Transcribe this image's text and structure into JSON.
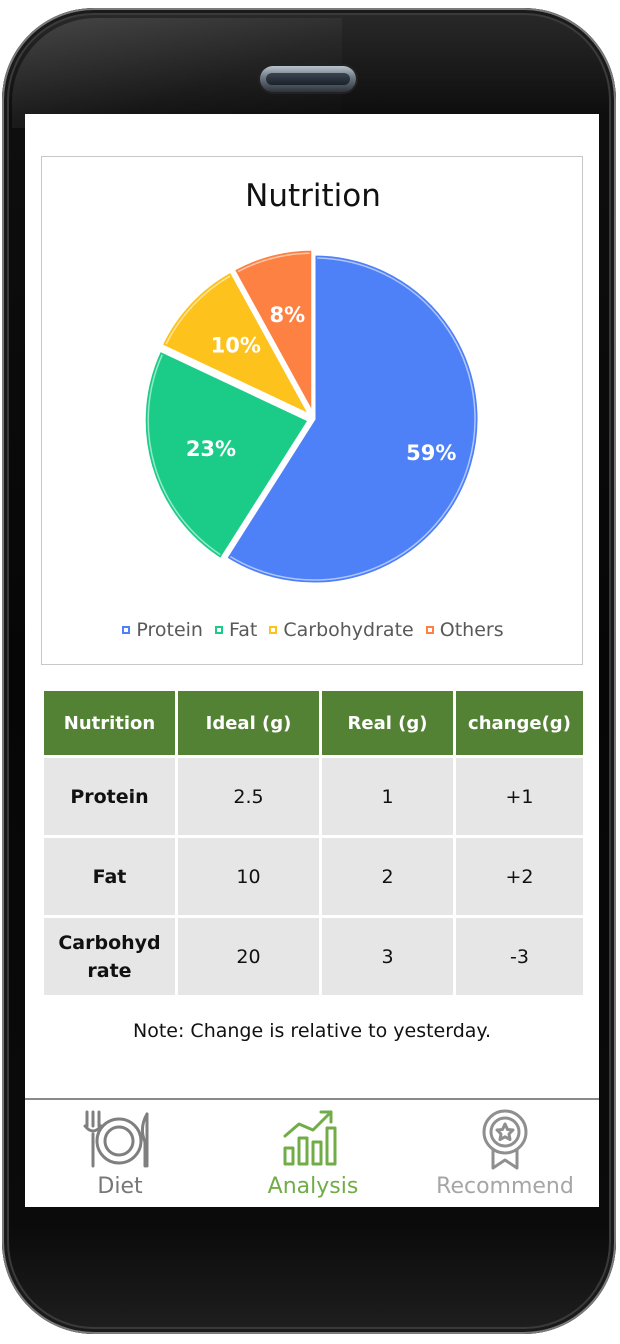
{
  "chart_data": {
    "type": "pie",
    "title": "Nutrition",
    "categories": [
      "Protein",
      "Fat",
      "Carbohydrate",
      "Others"
    ],
    "values": [
      59,
      23,
      10,
      8
    ],
    "data_labels": [
      "59%",
      "23%",
      "10%",
      "8%"
    ],
    "colors": [
      "#4e80f8",
      "#1bcc88",
      "#fdc21b",
      "#fc8142"
    ],
    "legend_position": "bottom"
  },
  "table": {
    "headers": [
      "Nutrition",
      "Ideal (g)",
      "Real (g)",
      "change(g)"
    ],
    "rows": [
      [
        "Protein",
        "2.5",
        "1",
        "+1"
      ],
      [
        "Fat",
        "10",
        "2",
        "+2"
      ],
      [
        "Carbohyd rate",
        "20",
        "3",
        "-3"
      ]
    ]
  },
  "note": "Note: Change is relative to yesterday.",
  "tabs": [
    {
      "label": "Diet",
      "icon": "plate-fork-knife-icon",
      "color": "#777777"
    },
    {
      "label": "Analysis",
      "icon": "bar-chart-trend-icon",
      "color": "#70ad47",
      "active": true
    },
    {
      "label": "Recommend",
      "icon": "award-badge-icon",
      "color": "#a6a6a6"
    }
  ]
}
